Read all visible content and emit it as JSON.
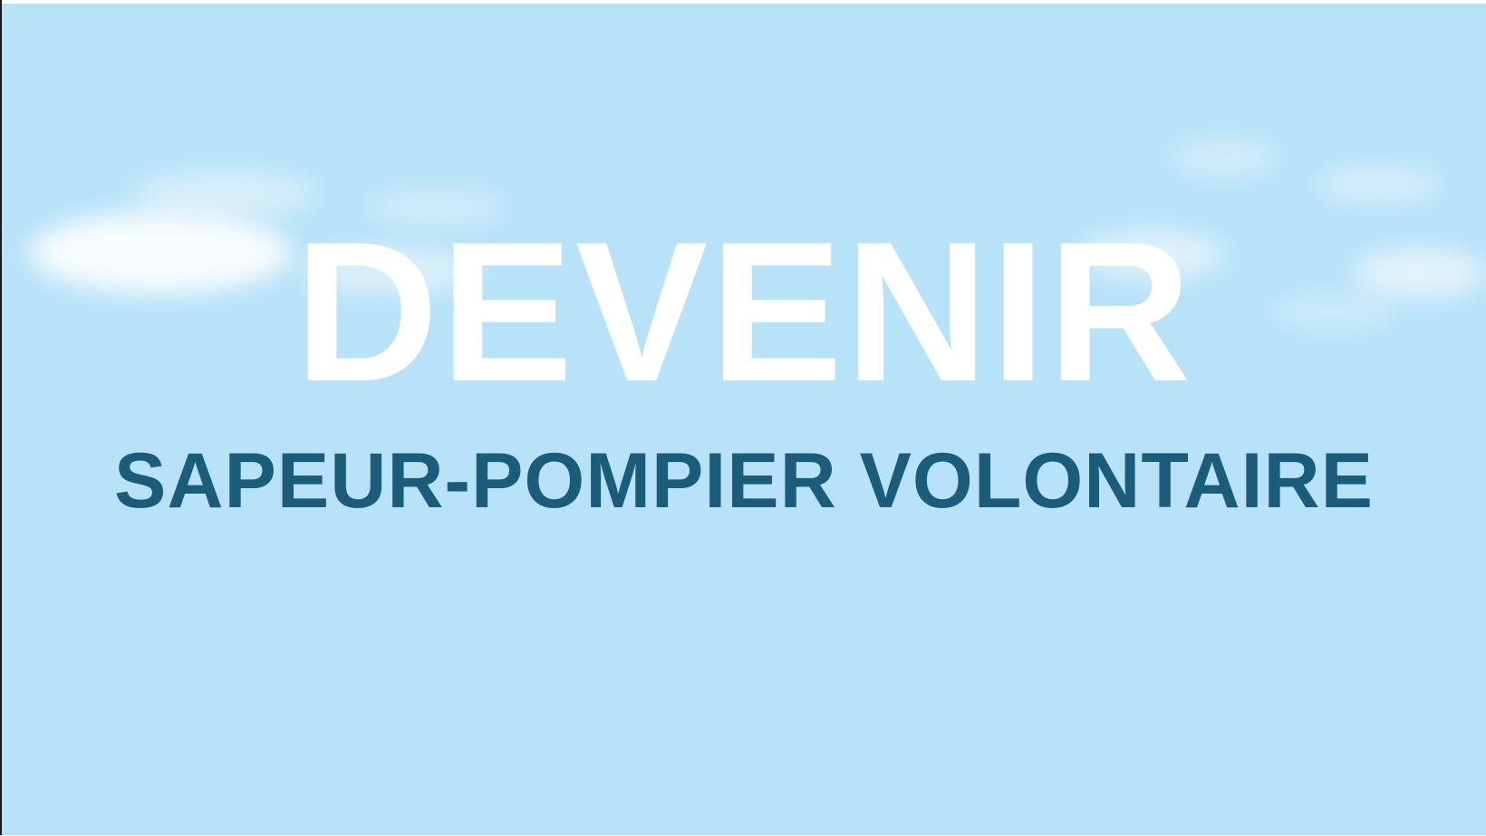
{
  "slide": {
    "title": "DEVENIR",
    "subtitle": "SAPEUR-POMPIER VOLONTAIRE"
  },
  "colors": {
    "sky": "#b8e2f8",
    "title": "#ffffff",
    "subtitle": "#1b5c7a"
  }
}
